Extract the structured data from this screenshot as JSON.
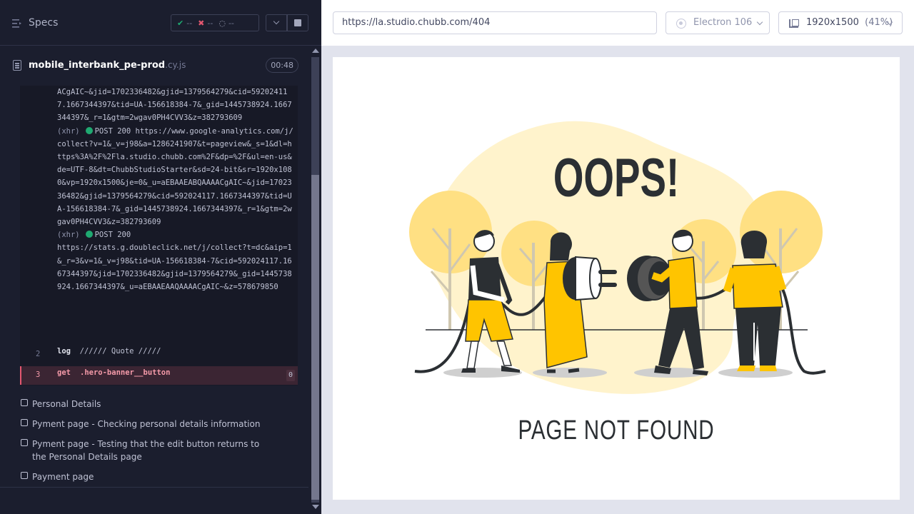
{
  "sidebar": {
    "title": "Specs",
    "stats": {
      "passed": "--",
      "failed": "--",
      "pending": "--"
    }
  },
  "spec": {
    "name": "mobile_interbank_pe-prod",
    "ext": ".cy.js",
    "duration": "00:48"
  },
  "command_log": {
    "lines": [
      "ACgAIC~&jid=1702336482&gjid=1379564279&cid=592024117.1667344397&tid=UA-156618384-7&_gid=1445738924.1667344397&_r=1&gtm=2wgav0PH4CVV3&z=382793609"
    ],
    "xhr1_prefix": "(xhr)",
    "xhr1_method": "POST 200",
    "xhr1_url": " https://www.google-analytics.com/j/collect?v=1&_v=j98&a=1286241907&t=pageview&_s=1&dl=https%3A%2F%2Fla.studio.chubb.com%2F&dp=%2F&ul=en-us&de=UTF-8&dt=ChubbStudioStarter&sd=24-bit&sr=1920x1080&vp=1920x1500&je=0&_u=aEBAAEABQAAAACgAIC~&jid=1702336482&gjid=1379564279&cid=592024117.1667344397&tid=UA-156618384-7&_gid=1445738924.1667344397&_r=1&gtm=2wgav0PH4CVV3&z=382793609",
    "xhr2_prefix": "(xhr)",
    "xhr2_method": "POST 200",
    "xhr2_url": "https://stats.g.doubleclick.net/j/collect?t=dc&aip=1&_r=3&v=1&_v=j98&tid=UA-156618384-7&cid=592024117.1667344397&jid=1702336482&gjid=1379564279&_gid=1445738924.1667344397&_u=aEBAAEAAQAAAACgAIC~&z=578679850",
    "row2_num": "2",
    "row2_cmd": "log",
    "row2_msg": "////// Quote /////",
    "row3_num": "3",
    "row3_cmd": "get",
    "row3_sel": ".hero-banner__button",
    "row3_count": "0"
  },
  "tests": [
    "Personal Details",
    "Pyment page - Checking personal details information",
    "Pyment page - Testing that the edit button returns to the Personal Details page",
    "Payment page"
  ],
  "browser_bar": {
    "url": "https://la.studio.chubb.com/404",
    "browser": "Electron 106",
    "viewport": "1920x1500",
    "scale": "(41%)"
  },
  "aut": {
    "heading": "OOPS!",
    "message": "PAGE NOT FOUND"
  },
  "colors": {
    "accent_yellow": "#ffc400",
    "light_yellow": "#ffe083",
    "blob": "#fff3cc",
    "ink": "#2b2f33",
    "pass": "#1fa971",
    "fail": "#e45770"
  }
}
